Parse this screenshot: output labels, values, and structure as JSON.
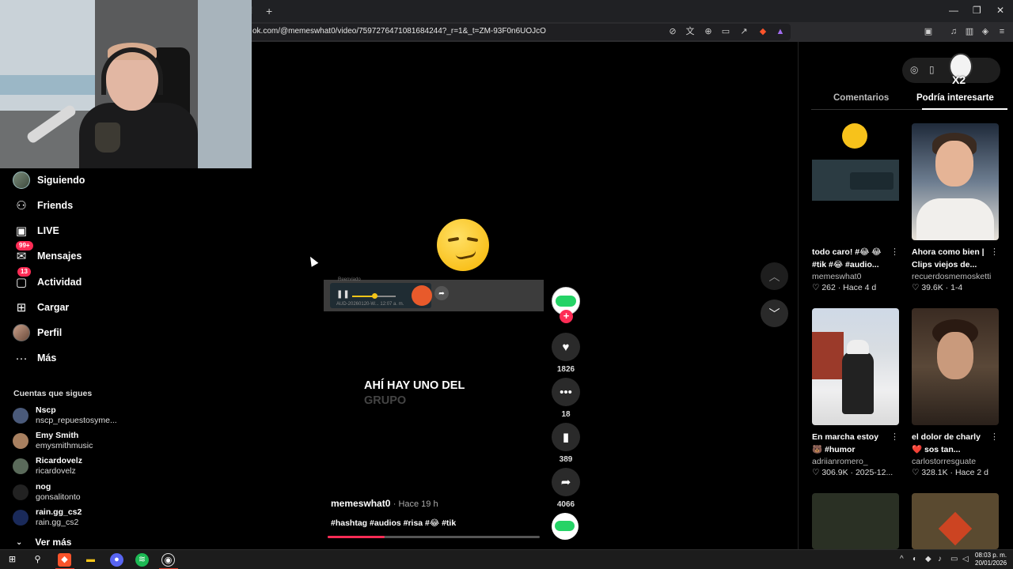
{
  "browser": {
    "new_tab_symbol": "+",
    "url": "ok.com/@memeswhat0/video/7597276471081684244?_r=1&_t=ZM-93F0n6UOJcO",
    "window_controls": [
      "—",
      "❐",
      "✕"
    ]
  },
  "sidebar": {
    "items": [
      {
        "label": "Siguiendo",
        "icon": "avatar"
      },
      {
        "label": "Friends",
        "icon": "friends-icon"
      },
      {
        "label": "LIVE",
        "icon": "live-icon"
      },
      {
        "label": "Mensajes",
        "icon": "messages-icon",
        "badge": "99+"
      },
      {
        "label": "Actividad",
        "icon": "activity-icon",
        "badge": "13"
      },
      {
        "label": "Cargar",
        "icon": "upload-icon"
      },
      {
        "label": "Perfil",
        "icon": "profile-avatar"
      },
      {
        "label": "Más",
        "icon": "more-icon"
      }
    ],
    "following_title": "Cuentas que sigues",
    "accounts": [
      {
        "name": "Nscp",
        "handle": "nscp_repuestosyme..."
      },
      {
        "name": "Emy Smith",
        "handle": "emysmithmusic"
      },
      {
        "name": "Ricardovelz",
        "handle": "ricardovelz"
      },
      {
        "name": "nog",
        "handle": "gonsalitonto"
      },
      {
        "name": "rain.gg_cs2",
        "handle": "rain.gg_cs2"
      }
    ],
    "see_more": "Ver más"
  },
  "video": {
    "caption_line1": "AHÍ HAY UNO DEL",
    "caption_line2": "GRUPO",
    "audio_top_label": "Reenviado",
    "audio_meta": "AUD-20260120-W...   12:07 a. m.",
    "author": "memeswhat0",
    "time": "· Hace 19 h",
    "hashtags": "#hashtag #audios #risa #😂 #tik",
    "progress": 0.27
  },
  "actions": {
    "likes": "1826",
    "comments": "18",
    "saves": "389",
    "shares": "4066"
  },
  "right_panel": {
    "tabs": [
      "Comentarios",
      "Podría interesarte"
    ],
    "active_tab": "Podría interesarte",
    "mascot_text": "X2",
    "cards": [
      {
        "title": "todo caro! #😂 😂 #tik #😂 #audio...",
        "author": "memeswhat0",
        "stats": "♡ 262 · Hace 4 d"
      },
      {
        "title": "Ahora como bien | Clips viejos de...",
        "author": "recuerdosmemosketti",
        "stats": "♡ 39.6K · 1-4"
      },
      {
        "title": "En marcha estoy 🐻 #humor",
        "author": "adriianromero_",
        "stats": "♡ 306.9K · 2025-12..."
      },
      {
        "title": "el dolor de charly ❤️ sos tan...",
        "author": "carlostorresguate",
        "stats": "♡ 328.1K · Hace 2 d"
      }
    ]
  },
  "taskbar": {
    "clock_time": "08:03 p. m.",
    "clock_date": "20/01/2026"
  },
  "colors": {
    "accent": "#fe2c55",
    "background": "#000000",
    "brave": "#fb542b"
  }
}
